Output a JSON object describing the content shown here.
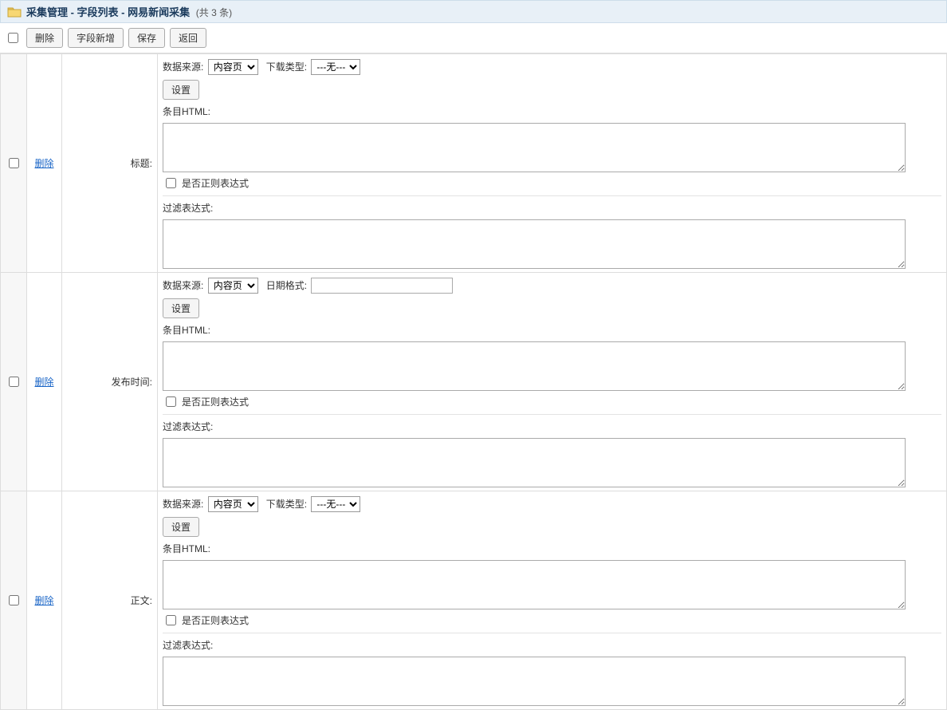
{
  "header": {
    "title": "采集管理 - 字段列表 - 网易新闻采集",
    "count_text": "(共 3 条)"
  },
  "toolbar": {
    "delete": "删除",
    "add_field": "字段新增",
    "save": "保存",
    "back": "返回"
  },
  "labels": {
    "data_source": "数据来源:",
    "download_type": "下载类型:",
    "date_format": "日期格式:",
    "settings_btn": "设置",
    "item_html": "条目HTML:",
    "is_regex": "是否正则表达式",
    "filter_expr": "过滤表达式:",
    "delete_link": "删除"
  },
  "select_options": {
    "data_source": [
      "内容页"
    ],
    "download_type": [
      "---无---"
    ]
  },
  "rows": [
    {
      "field_label": "标题:",
      "show_download_type": true,
      "show_date_format": false,
      "data_source_value": "内容页",
      "download_type_value": "---无---",
      "date_format_value": "",
      "item_html_value": "",
      "is_regex_checked": false,
      "filter_value": ""
    },
    {
      "field_label": "发布时间:",
      "show_download_type": false,
      "show_date_format": true,
      "data_source_value": "内容页",
      "download_type_value": "",
      "date_format_value": "",
      "item_html_value": "",
      "is_regex_checked": false,
      "filter_value": ""
    },
    {
      "field_label": "正文:",
      "show_download_type": true,
      "show_date_format": false,
      "data_source_value": "内容页",
      "download_type_value": "---无---",
      "date_format_value": "",
      "item_html_value": "",
      "is_regex_checked": false,
      "filter_value": ""
    }
  ]
}
